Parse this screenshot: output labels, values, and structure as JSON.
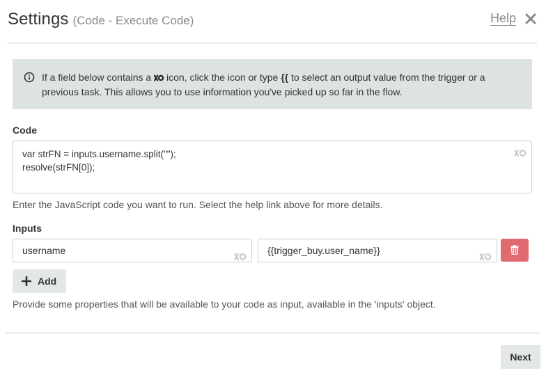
{
  "header": {
    "title": "Settings",
    "subtitle": "(Code - Execute Code)",
    "help_label": "Help",
    "close_icon": "close-x-icon"
  },
  "info": {
    "icon": "info-circle-icon",
    "text_before_icon": "If a field below contains a ",
    "inline_icon": "variable-picker-icon",
    "text_after_icon": " icon, click the icon or type ",
    "brace_token": "{{",
    "text_after_brace": " to select an output value from the trigger or a",
    "line2": "previous task. This allows you to use information you've picked up so far in the flow."
  },
  "code": {
    "label": "Code",
    "lines": [
      "var strFN = inputs.username.split(\"\");",
      "resolve(strFN[0]);"
    ],
    "hint": "Enter the JavaScript code you want to run. Select the help link above for more details."
  },
  "inputs": {
    "label": "Inputs",
    "rows": [
      {
        "key": "username",
        "value": "{{trigger_buy.user_name}}"
      }
    ],
    "add_label": "Add",
    "hint": "Provide some properties that will be available to your code as input, available in the 'inputs' object."
  },
  "footer": {
    "next_label": "Next"
  },
  "colors": {
    "info_bg": "#dde3de",
    "delete_bg": "#e06a70",
    "button_bg": "#e4e8e5",
    "muted_text": "#8a8a8a"
  }
}
